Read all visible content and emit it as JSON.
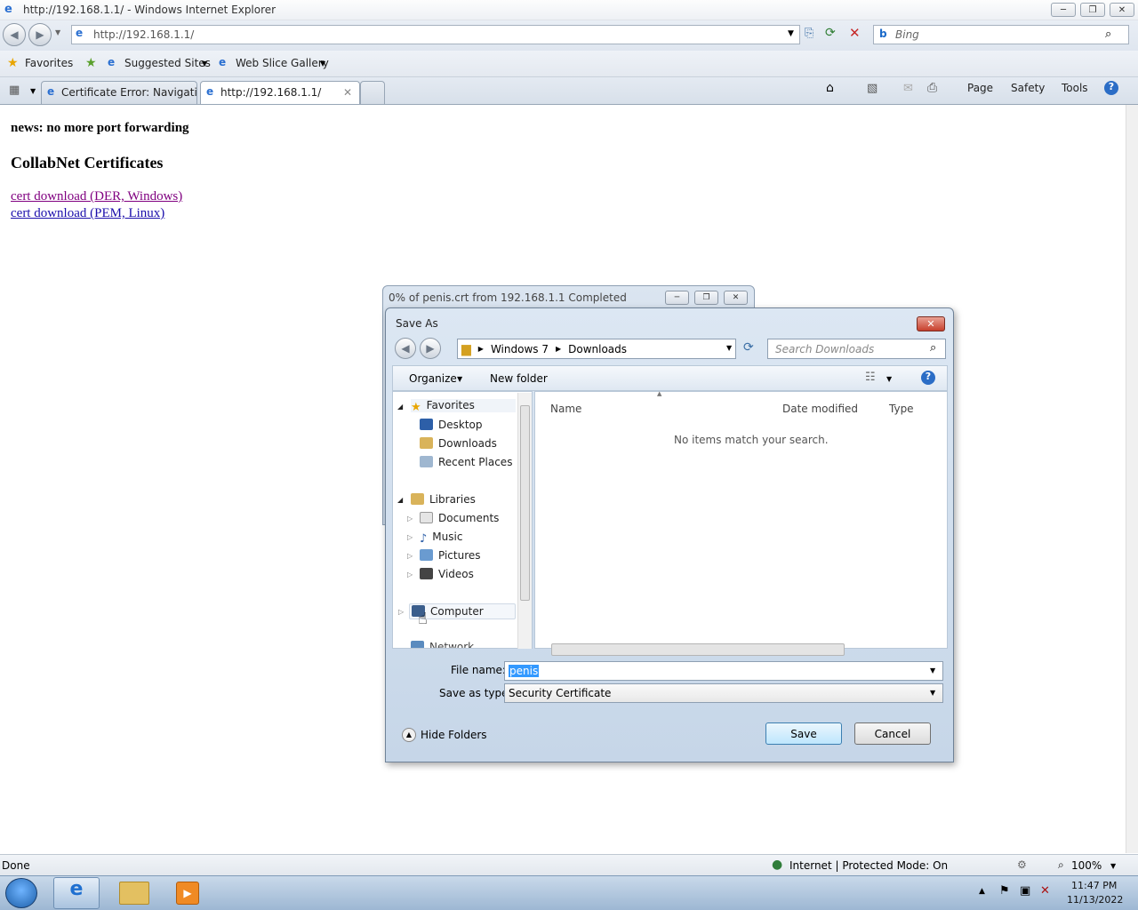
{
  "window": {
    "title": "http://192.168.1.1/ - Windows Internet Explorer"
  },
  "address": {
    "url": "http://192.168.1.1/",
    "search_placeholder": "Bing"
  },
  "favbar": {
    "favorites": "Favorites",
    "suggested": "Suggested Sites",
    "webslice": "Web Slice Gallery"
  },
  "tabs": [
    {
      "label": "Certificate Error: Navigatio..."
    },
    {
      "label": "http://192.168.1.1/"
    }
  ],
  "commandbar": {
    "page": "Page",
    "safety": "Safety",
    "tools": "Tools"
  },
  "page": {
    "news": "news: no more port forwarding",
    "heading": "CollabNet Certificates",
    "link1": "cert download (DER, Windows)",
    "link2": "cert download (PEM, Linux)"
  },
  "download": {
    "title": "0% of penis.crt from 192.168.1.1 Completed"
  },
  "dialog": {
    "title": "Save As",
    "breadcrumb": [
      "Windows 7",
      "Downloads"
    ],
    "search_placeholder": "Search Downloads",
    "organize": "Organize",
    "new_folder": "New folder",
    "columns": {
      "name": "Name",
      "date": "Date modified",
      "type": "Type"
    },
    "empty_message": "No items match your search.",
    "nav": {
      "favorites": "Favorites",
      "desktop": "Desktop",
      "downloads": "Downloads",
      "recent": "Recent Places",
      "libraries": "Libraries",
      "documents": "Documents",
      "music": "Music",
      "pictures": "Pictures",
      "videos": "Videos",
      "computer": "Computer",
      "network": "Network"
    },
    "filename_label": "File name:",
    "filename_value": "penis",
    "savetype_label": "Save as type:",
    "savetype_value": "Security Certificate",
    "hide_folders": "Hide Folders",
    "save": "Save",
    "cancel": "Cancel"
  },
  "status": {
    "text": "Done",
    "zone": "Internet | Protected Mode: On",
    "zoom": "100%"
  },
  "taskbar": {
    "time": "11:47 PM",
    "date": "11/13/2022"
  }
}
